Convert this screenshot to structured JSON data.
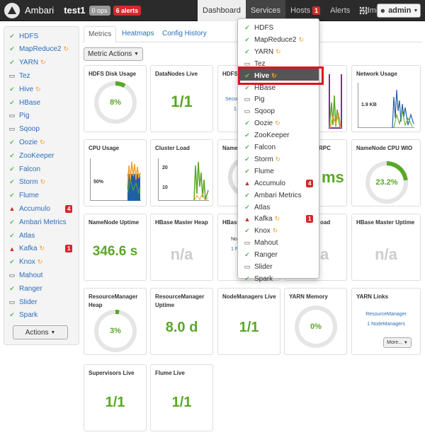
{
  "header": {
    "brand": "Ambari",
    "cluster": "test1",
    "ops_badge": "0 ops",
    "alerts_badge": "6 alerts",
    "nav": [
      {
        "label": "Dashboard",
        "state": "active"
      },
      {
        "label": "Services",
        "state": "open"
      },
      {
        "label": "Hosts",
        "state": "",
        "badge": "1"
      },
      {
        "label": "Alerts",
        "state": ""
      },
      {
        "label": "Admin",
        "state": ""
      }
    ],
    "admin_label": "admin"
  },
  "sidebar": {
    "items": [
      {
        "label": "HDFS",
        "status": "ok"
      },
      {
        "label": "MapReduce2",
        "status": "ok",
        "refresh": true
      },
      {
        "label": "YARN",
        "status": "ok",
        "refresh": true
      },
      {
        "label": "Tez",
        "status": "client"
      },
      {
        "label": "Hive",
        "status": "ok",
        "refresh": true
      },
      {
        "label": "HBase",
        "status": "ok"
      },
      {
        "label": "Pig",
        "status": "client"
      },
      {
        "label": "Sqoop",
        "status": "client"
      },
      {
        "label": "Oozie",
        "status": "ok",
        "refresh": true
      },
      {
        "label": "ZooKeeper",
        "status": "ok"
      },
      {
        "label": "Falcon",
        "status": "ok"
      },
      {
        "label": "Storm",
        "status": "ok",
        "refresh": true
      },
      {
        "label": "Flume",
        "status": "ok"
      },
      {
        "label": "Accumulo",
        "status": "alert",
        "alerts": "4"
      },
      {
        "label": "Ambari Metrics",
        "status": "ok"
      },
      {
        "label": "Atlas",
        "status": "ok"
      },
      {
        "label": "Kafka",
        "status": "alert",
        "refresh": true,
        "alerts": "1"
      },
      {
        "label": "Knox",
        "status": "ok",
        "refresh": true
      },
      {
        "label": "Mahout",
        "status": "client"
      },
      {
        "label": "Ranger",
        "status": "ok"
      },
      {
        "label": "Slider",
        "status": "client"
      },
      {
        "label": "Spark",
        "status": "ok"
      }
    ],
    "actions_label": "Actions"
  },
  "tabs": [
    {
      "label": "Metrics",
      "active": true
    },
    {
      "label": "Heatmaps",
      "active": false
    },
    {
      "label": "Config History",
      "active": false
    }
  ],
  "metric_actions_label": "Metric Actions",
  "widgets": {
    "hdfs_disk": {
      "title": "HDFS Disk Usage",
      "value": "8%",
      "percent": 8
    },
    "datanodes": {
      "title": "DataNodes Live",
      "value": "1/1"
    },
    "hdfs_links": {
      "title": "HDFS",
      "link1": "Secon",
      "link2": "1"
    },
    "network": {
      "title": "Network Usage",
      "label": "1.9 KB"
    },
    "cpu": {
      "title": "CPU Usage",
      "label": "50%"
    },
    "cluster_load": {
      "title": "Cluster Load",
      "label_top": "20",
      "label_mid": "10"
    },
    "namenode_heap": {
      "title": "NameN"
    },
    "namenode_rpc": {
      "title": "RPC",
      "value": "ms"
    },
    "namenode_cpu": {
      "title": "NameNode CPU WIO",
      "value": "23.2%",
      "percent": 23.2
    },
    "namenode_uptime": {
      "title": "NameNode Uptime",
      "value": "346.6 s"
    },
    "hbase_heap": {
      "title": "HBase Master Heap",
      "value": "n/a"
    },
    "hbase_links": {
      "title": "HBase",
      "text1": "No",
      "text2": "1 F"
    },
    "hbase_load": {
      "title": "oad",
      "value": "a"
    },
    "hbase_uptime": {
      "title": "HBase Master Uptime",
      "value": "n/a"
    },
    "rm_heap": {
      "title": "ResourceManager Heap",
      "value": "3%",
      "percent": 3
    },
    "rm_uptime": {
      "title": "ResourceManager Uptime",
      "value": "8.0 d"
    },
    "nm_live": {
      "title": "NodeManagers Live",
      "value": "1/1"
    },
    "yarn_memory": {
      "title": "YARN Memory",
      "value": "0%",
      "percent": 0
    },
    "yarn_links": {
      "title": "YARN Links",
      "link1": "ResourceManager",
      "link2": "1 NodeManagers",
      "more": "More..."
    },
    "supervisors": {
      "title": "Supervisors Live",
      "value": "1/1"
    },
    "flume": {
      "title": "Flume Live",
      "value": "1/1"
    }
  },
  "dropdown": {
    "items": [
      {
        "label": "HDFS",
        "status": "ok"
      },
      {
        "label": "MapReduce2",
        "status": "ok",
        "refresh": true
      },
      {
        "label": "YARN",
        "status": "ok",
        "refresh": true
      },
      {
        "label": "Tez",
        "status": "client"
      },
      {
        "label": "Hive",
        "status": "ok",
        "refresh": true,
        "hover": true
      },
      {
        "label": "HBase",
        "status": "ok"
      },
      {
        "label": "Pig",
        "status": "client"
      },
      {
        "label": "Sqoop",
        "status": "client"
      },
      {
        "label": "Oozie",
        "status": "ok",
        "refresh": true
      },
      {
        "label": "ZooKeeper",
        "status": "ok"
      },
      {
        "label": "Falcon",
        "status": "ok"
      },
      {
        "label": "Storm",
        "status": "ok",
        "refresh": true
      },
      {
        "label": "Flume",
        "status": "ok"
      },
      {
        "label": "Accumulo",
        "status": "alert",
        "alerts": "4"
      },
      {
        "label": "Ambari Metrics",
        "status": "ok"
      },
      {
        "label": "Atlas",
        "status": "ok"
      },
      {
        "label": "Kafka",
        "status": "alert",
        "refresh": true,
        "alerts": "1"
      },
      {
        "label": "Knox",
        "status": "ok",
        "refresh": true
      },
      {
        "label": "Mahout",
        "status": "client"
      },
      {
        "label": "Ranger",
        "status": "ok"
      },
      {
        "label": "Slider",
        "status": "client"
      },
      {
        "label": "Spark",
        "status": "ok"
      }
    ]
  },
  "colors": {
    "ok": "#5cb85c",
    "alert": "#d32a2a",
    "link": "#2a6ebb",
    "highlight": "#e0121b"
  }
}
